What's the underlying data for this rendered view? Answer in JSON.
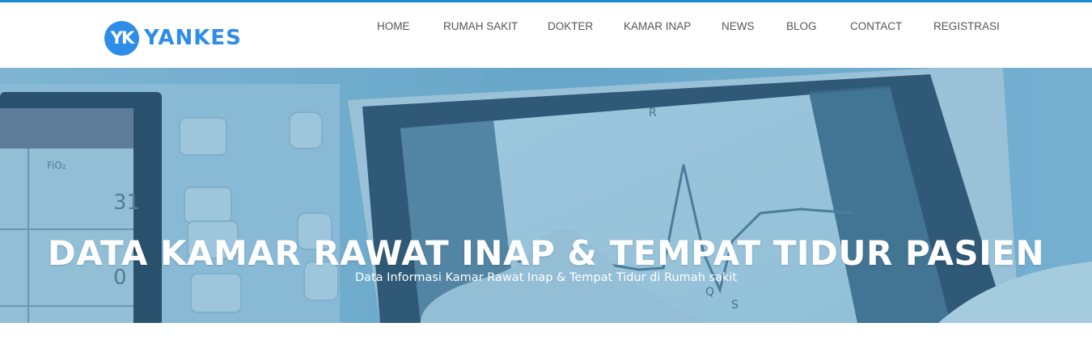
{
  "brand": {
    "badge": "YK",
    "name": "YANKES",
    "color": "#2d8de8"
  },
  "nav": {
    "items": [
      {
        "label": "HOME"
      },
      {
        "label": "RUMAH SAKIT"
      },
      {
        "label": "DOKTER"
      },
      {
        "label": "KAMAR INAP"
      },
      {
        "label": "NEWS"
      },
      {
        "label": "BLOG"
      },
      {
        "label": "CONTACT"
      },
      {
        "label": "REGISTRASI"
      }
    ]
  },
  "hero": {
    "title": "DATA KAMAR RAWAT INAP & TEMPAT TIDUR PASIEN",
    "subtitle": "Data Informasi Kamar Rawat Inap & Tempat Tidur di Rumah sakit",
    "overlay_color": "#5ba3cc",
    "background_description_icon": "medical-monitor-image"
  },
  "accent_colors": {
    "topline": "#1a8cd8",
    "nav_text": "#555555"
  }
}
